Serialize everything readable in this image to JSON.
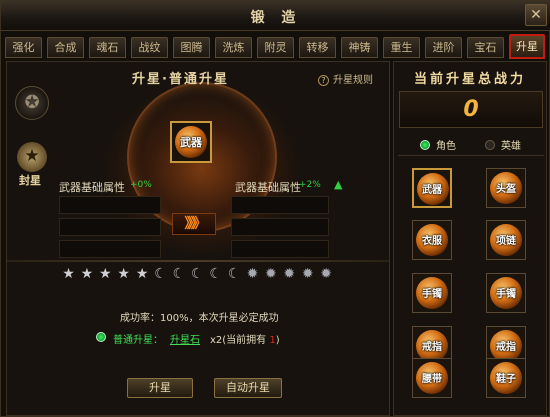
{
  "window": {
    "title": "锻 造",
    "close_glyph": "✕"
  },
  "tabs": [
    "强化",
    "合成",
    "魂石",
    "战纹",
    "图腾",
    "洗炼",
    "附灵",
    "转移",
    "神铸",
    "重生",
    "进阶",
    "宝石",
    "升星"
  ],
  "active_tab": "升星",
  "left": {
    "panel_title": "升星·普通升星",
    "rules_link": "升星规则",
    "seal_label": "封星",
    "main_slot_label": "武器",
    "attr_before_label": "武器基础属性",
    "attr_before_value": "+0%",
    "attr_after_label": "武器基础属性",
    "attr_after_value": "+2%",
    "arrows": "》》》",
    "stars": [
      "full",
      "full",
      "full",
      "full",
      "full",
      "moon",
      "moon",
      "moon",
      "moon",
      "moon",
      "gear",
      "gear",
      "gear",
      "gear",
      "gear"
    ],
    "success_text": "成功率：100%，本次升星必定成功",
    "normal_label": "普通升星：",
    "stone_label": "升星石",
    "count_prefix": "x2(当前拥有 ",
    "count_owned": "1",
    "count_suffix": ")",
    "btn_upgrade": "升星",
    "btn_auto": "自动升星"
  },
  "right": {
    "title": "当前升星总战力",
    "power": "0",
    "role_label": "角色",
    "hero_label": "英雄",
    "slots": [
      "武器",
      "头盔",
      "衣服",
      "项链",
      "手镯",
      "手镯",
      "戒指",
      "戒指",
      "腰带",
      "鞋子"
    ],
    "selected_slot": 0
  },
  "colors": {
    "accent_gold": "#c89a3c",
    "active_tab_border": "#c21c12",
    "green": "#2fd243",
    "power": "#f2b640"
  }
}
